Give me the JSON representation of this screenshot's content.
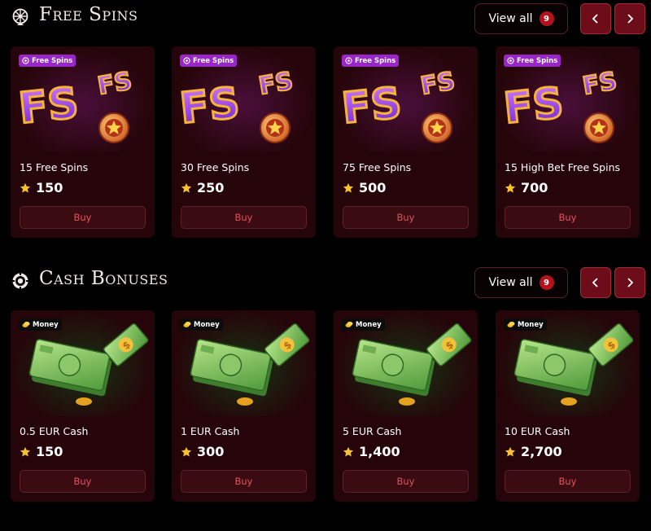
{
  "free_spins": {
    "title": "Free Spins",
    "view_all_label": "View all",
    "count": "9",
    "items": [
      {
        "tag": "Free Spins",
        "name": "15 Free Spins",
        "price": "150",
        "buy": "Buy",
        "art_text": "FS"
      },
      {
        "tag": "Free Spins",
        "name": "30 Free Spins",
        "price": "250",
        "buy": "Buy",
        "art_text": "FS"
      },
      {
        "tag": "Free Spins",
        "name": "75 Free Spins",
        "price": "500",
        "buy": "Buy",
        "art_text": "FS"
      },
      {
        "tag": "Free Spins",
        "name": "15 High Bet Free Spins",
        "price": "700",
        "buy": "Buy",
        "art_text": "FS"
      }
    ]
  },
  "cash_bonuses": {
    "title": "Cash Bonuses",
    "view_all_label": "View all",
    "count": "9",
    "items": [
      {
        "tag": "Money",
        "name": "0.5 EUR Cash",
        "price": "150",
        "buy": "Buy"
      },
      {
        "tag": "Money",
        "name": "1 EUR Cash",
        "price": "300",
        "buy": "Buy"
      },
      {
        "tag": "Money",
        "name": "5 EUR Cash",
        "price": "1,400",
        "buy": "Buy"
      },
      {
        "tag": "Money",
        "name": "10 EUR Cash",
        "price": "2,700",
        "buy": "Buy"
      }
    ]
  },
  "colors": {
    "accent": "#b4121f",
    "card_bg": "#250509",
    "buy_text": "#e05261",
    "star": "#f6c32a"
  },
  "icons": [
    "wheel-icon",
    "chip-icon",
    "chevron-left-icon",
    "chevron-right-icon",
    "star-icon",
    "target-icon",
    "coin-icon"
  ]
}
